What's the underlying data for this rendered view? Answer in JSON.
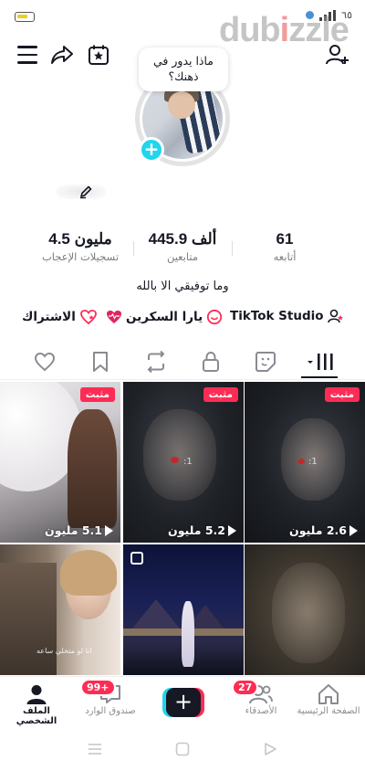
{
  "status_bar": {
    "right_text": "٦٥"
  },
  "watermark": {
    "text_pre": "dub",
    "text_flame": "i",
    "text_post": "zzle"
  },
  "profile": {
    "thought_bubble": "ماذا يدور في ذهنك؟",
    "bio": "وما توفيقي الا بالله"
  },
  "stats": [
    {
      "value": "61",
      "label": "أتابعه"
    },
    {
      "value": "445.9 ألف",
      "label": "متابعين"
    },
    {
      "value": "4.5 مليون",
      "label": "تسجيلات الإعجاب"
    }
  ],
  "links": {
    "studio": "TikTok Studio",
    "screen_yara": "يارا السكرين",
    "subscribe": "الاشتراك"
  },
  "videos": [
    {
      "pinned": "مثبت",
      "views": "5.1 مليون"
    },
    {
      "pinned": "مثبت",
      "views": "5.2 مليون"
    },
    {
      "pinned": "مثبت",
      "views": "2.6 مليون"
    },
    {
      "caption": "انا لو متخلي ساعه"
    },
    {},
    {}
  ],
  "overlay_text": {
    "watch_1": ":1",
    "watch_2": ":1"
  },
  "bottom_nav": {
    "home": "الصفحة الرئيسية",
    "friends": "الأصدقاء",
    "friends_badge": "27",
    "inbox": "صندوق الوارد",
    "inbox_badge": "99+",
    "profile": "الملف الشخصي"
  },
  "colors": {
    "accent_red": "#fe2c55",
    "accent_cyan": "#20d5ec",
    "text": "#161823"
  }
}
